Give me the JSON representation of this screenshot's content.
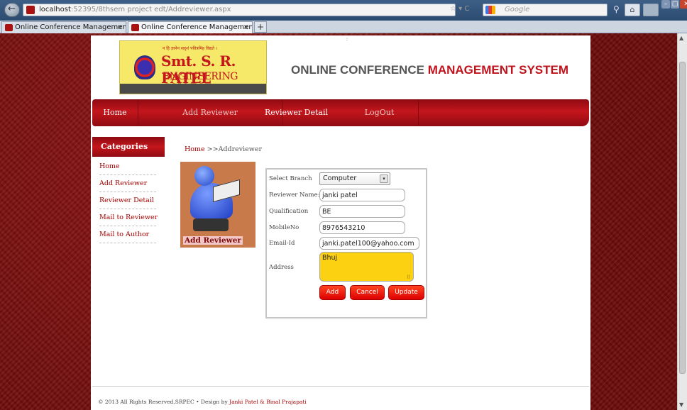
{
  "browser": {
    "url_host": "localhost",
    "url_rest": ":52395/8thsem project edt/Addreviewer.aspx",
    "search_placeholder": "Google",
    "tabs": [
      {
        "label": "Online Conference Management Syst...",
        "close": "×"
      },
      {
        "label": "Online Conference Management Syst...",
        "close": "×"
      }
    ],
    "new_tab": "+"
  },
  "header": {
    "logo_hindi": "न हि ज्ञानेन सदृशं पवित्रमिह विद्यते ।",
    "logo_line1": "Smt. S. R. PATEL",
    "logo_line2": "ENGINEERING COLLEGE",
    "title_part1": "ONLINE CONFERENCE ",
    "title_part2": "MANAGEMENT SYSTEM",
    "accent_color": "#c0121b"
  },
  "nav": {
    "items": [
      {
        "label": "Home"
      },
      {
        "label": "Add Reviewer"
      },
      {
        "label": "Reviewer Detail"
      },
      {
        "label": "LogOut"
      }
    ]
  },
  "sidebar": {
    "heading": "Categories",
    "items": [
      {
        "label": "Home"
      },
      {
        "label": "Add Reviewer"
      },
      {
        "label": "Reviewer Detail"
      },
      {
        "label": "Mail to Reviewer"
      },
      {
        "label": "Mail to Author"
      }
    ]
  },
  "breadcrumb": {
    "home": "Home",
    "rest": " >>Addreviewer"
  },
  "reviewer_image": {
    "caption": "Add Reviewer"
  },
  "form": {
    "branch_label": "Select Branch",
    "branch_value": "Computer",
    "name_label": "Reviewer Name:",
    "name_value": "janki patel",
    "qual_label": "Qualification",
    "qual_value": "BE",
    "mobile_label": "MobileNo",
    "mobile_value": "8976543210",
    "email_label": "Email-Id",
    "email_value": "janki.patel100@yahoo.com",
    "address_label": "Address",
    "address_value": "Bhuj",
    "address_color": "#fbd112",
    "buttons": {
      "add": "Add",
      "cancel": "Cancel",
      "update": "Update"
    }
  },
  "footer": {
    "copyright": "© 2013 All Rights Reserved,SRPEC • Design by ",
    "authors": "Janki Patel & Binal Prajapati"
  }
}
